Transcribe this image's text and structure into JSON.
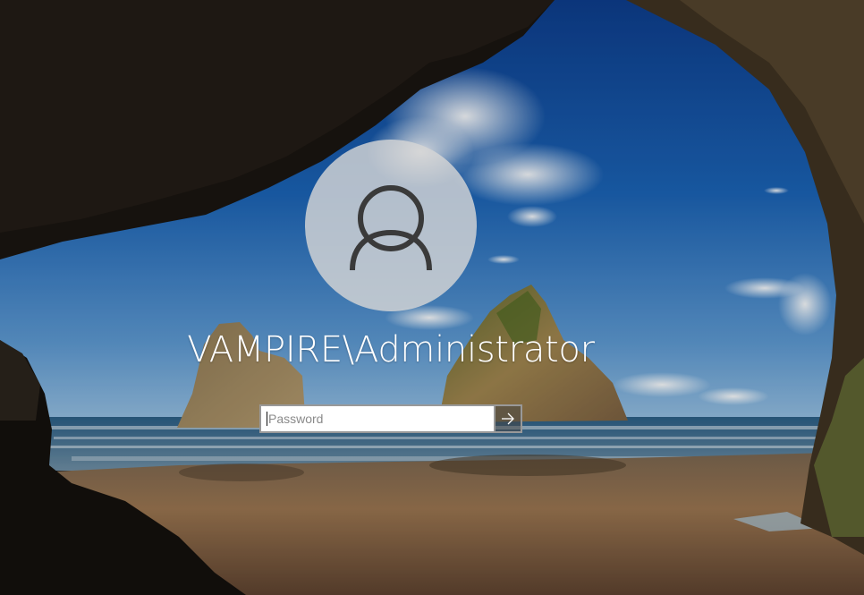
{
  "login": {
    "user": "VAMPIRE\\Administrator",
    "password_placeholder": "Password",
    "avatar_icon": "user-icon",
    "submit_icon": "arrow-right-icon"
  },
  "colors": {
    "input_border": "#999999",
    "avatar_bg": "#d6d6d6",
    "text": "#ffffff"
  }
}
